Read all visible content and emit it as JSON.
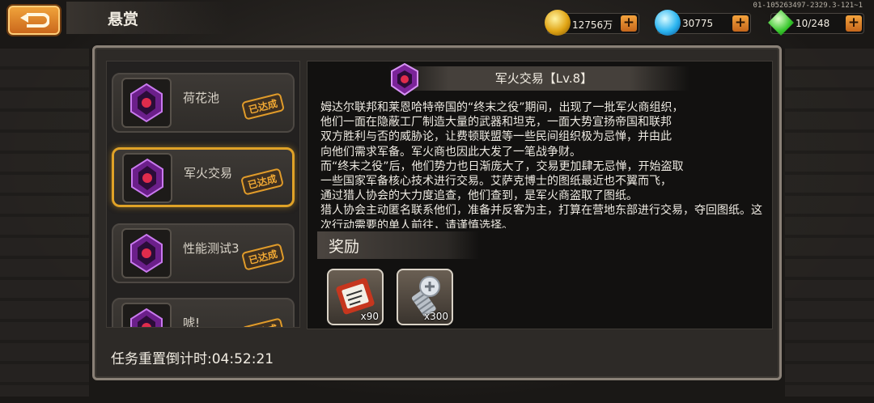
{
  "header": {
    "title": "悬赏",
    "server_id": "01-105263497-2329.3-121~1"
  },
  "resources": {
    "gold": {
      "value": "12756万",
      "icon": "gold-coin-icon"
    },
    "diamond": {
      "value": "30775",
      "icon": "diamond-icon"
    },
    "energy": {
      "value": "10/248",
      "icon": "energy-crystal-icon"
    },
    "plus_label": "+"
  },
  "tasks": [
    {
      "name": "荷花池",
      "status": "已达成",
      "selected": false
    },
    {
      "name": "军火交易",
      "status": "已达成",
      "selected": true
    },
    {
      "name": "性能测试3",
      "status": "已达成",
      "selected": false
    },
    {
      "name": "唬!",
      "status": "已达成",
      "selected": false
    }
  ],
  "detail": {
    "title": "军火交易【Lv.8】",
    "description": "姆达尔联邦和莱恩哈特帝国的“终末之役”期间，出现了一批军火商组织，\n他们一面在隐蔽工厂制造大量的武器和坦克，一面大势宣扬帝国和联邦\n双方胜利与否的威胁论，让费顿联盟等一些民间组织极为忌惮，并由此\n向他们需求军备。军火商也因此大发了一笔战争财。\n而“终末之役”后，他们势力也日渐庞大了，交易更加肆无忌惮，开始盗取\n一些国家军备核心技术进行交易。艾萨克博士的图纸最近也不翼而飞，\n通过猎人协会的大力度追查，他们查到，是军火商盗取了图纸。\n猎人协会主动匿名联系他们，准备并反客为主，打算在营地东部进行交易，夺回图纸。这次行动需要的单人前往，请谨慎选择。",
    "rewards_label": "奖励",
    "rewards": [
      {
        "icon": "ticket-scroll-icon",
        "qty": "x90"
      },
      {
        "icon": "screw-bolt-icon",
        "qty": "x300"
      }
    ]
  },
  "footer": {
    "countdown": "任务重置倒计时:04:52:21"
  },
  "colors": {
    "accent_orange": "#e0a227",
    "frame_border": "#8a8177",
    "badge_purple": "#a23ad0"
  }
}
